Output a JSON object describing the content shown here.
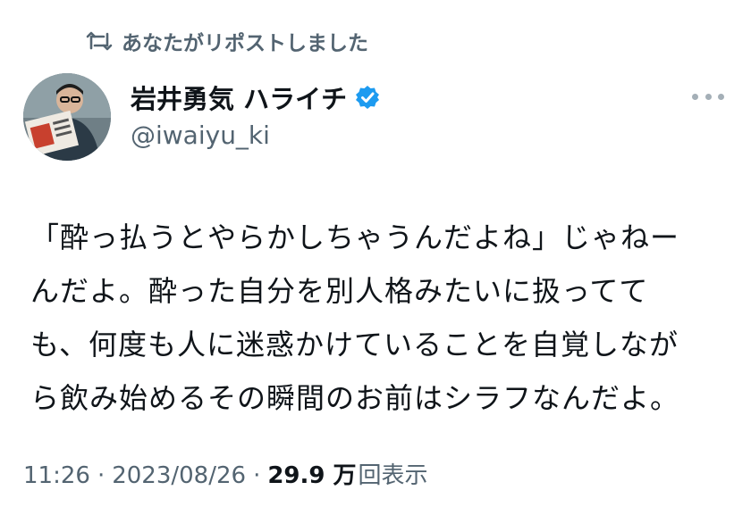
{
  "repost": {
    "label": "あなたがリポストしました",
    "icon": "repost-icon"
  },
  "author": {
    "display_name": "岩井勇気 ハライチ",
    "handle": "@iwaiyu_ki",
    "verified": true,
    "verified_color": "#1d9bf0"
  },
  "tweet": {
    "lines": [
      "「酔っ払うとやらかしちゃうんだよね」じゃねー",
      "んだよ。酔った自分を別人格みたいに扱ってて",
      "も、何度も人に迷惑かけていることを自覚しなが",
      "ら飲み始めるその瞬間のお前はシラフなんだよ。"
    ]
  },
  "meta": {
    "time": "11:26",
    "separator": "·",
    "date": "2023/08/26",
    "views_count": "29.9 万",
    "views_label": "回表示"
  },
  "colors": {
    "text_primary": "#0f1419",
    "text_secondary": "#536471",
    "more_dots": "#a4afb7"
  }
}
